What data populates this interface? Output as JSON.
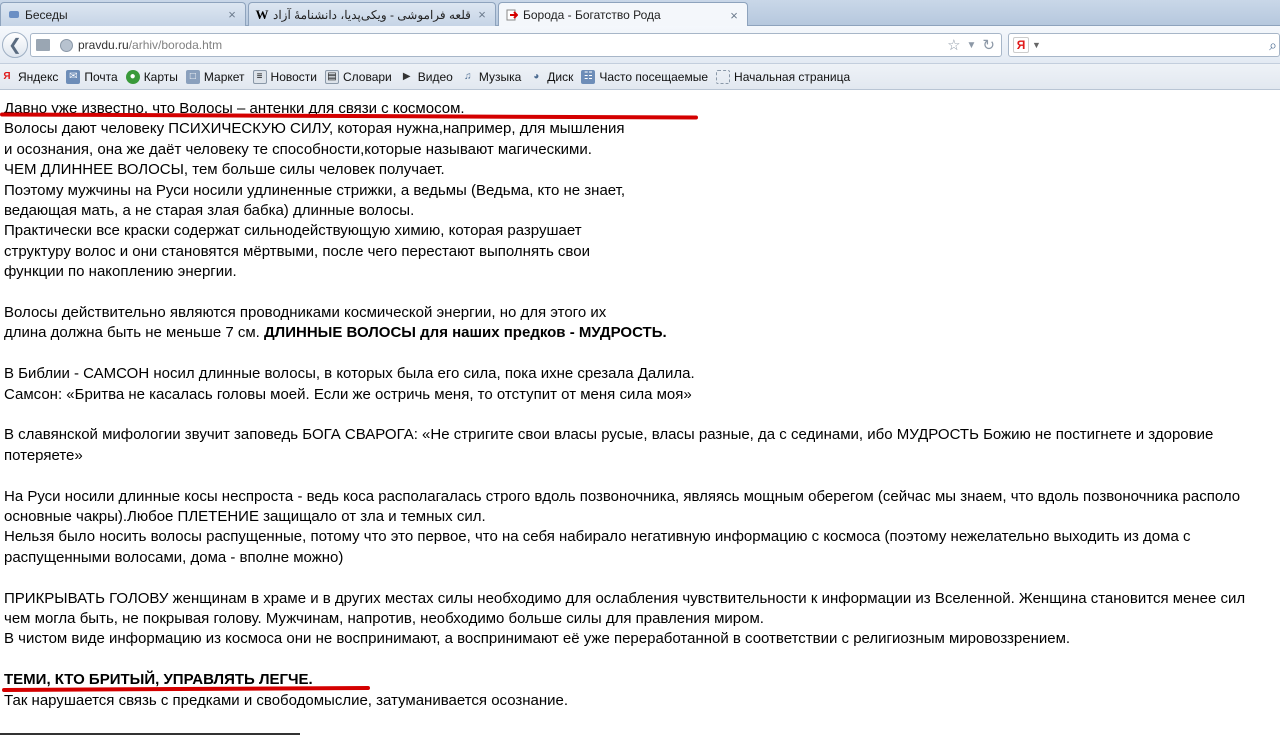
{
  "tabs": [
    {
      "title": "Беседы",
      "close": "×"
    },
    {
      "title": "قلعه فراموشی - ویکی‌پدیا، دانشنامهٔ آزاد",
      "close": "×"
    },
    {
      "title": "Борода - Богатство Рода",
      "close": "×"
    }
  ],
  "nav": {
    "url_domain": "pravdu.ru",
    "url_path": "/arhiv/boroda.htm",
    "search_brand": "Я"
  },
  "bookmarks": [
    {
      "label": "Яндекс",
      "icon": "yandex-icon"
    },
    {
      "label": "Почта",
      "icon": "mail-icon"
    },
    {
      "label": "Карты",
      "icon": "maps-icon"
    },
    {
      "label": "Маркет",
      "icon": "market-icon"
    },
    {
      "label": "Новости",
      "icon": "news-icon"
    },
    {
      "label": "Словари",
      "icon": "dictionary-icon"
    },
    {
      "label": "Видео",
      "icon": "video-icon"
    },
    {
      "label": "Музыка",
      "icon": "music-icon"
    },
    {
      "label": "Диск",
      "icon": "disk-icon"
    },
    {
      "label": "Часто посещаемые",
      "icon": "frequent-icon"
    },
    {
      "label": "Начальная страница",
      "icon": "page-icon"
    }
  ],
  "article": {
    "l01": "Давно уже известно, что Волосы – антенки для связи с космосом.",
    "l02": "Волосы дают человеку ПСИХИЧЕСКУЮ СИЛУ, которая нужна,например, для мышления",
    "l03": "и осознания, она же даёт человеку те способности,которые называют магическими.",
    "l04": "ЧЕМ ДЛИННЕЕ ВОЛОСЫ, тем больше силы человек получает.",
    "l05": "Поэтому мужчины на Руси носили удлиненные стрижки, а ведьмы (Ведьма, кто не знает,",
    "l06": "ведающая мать, а не старая злая бабка) длинные волосы.",
    "l07": "Практически все краски содержат сильнодействующую химию, которая разрушает",
    "l08": "структуру волос и они становятся мёртвыми, после чего перестают выполнять свои",
    "l09": "функции по накоплению энергии.",
    "l10": "Волосы действительно являются проводниками космической энергии, но для этого их",
    "l11a": "длина должна быть не меньше 7 см. ",
    "l11b": "ДЛИННЫЕ ВОЛОСЫ для наших предков - МУДРОСТЬ.",
    "l12": "В Библии - САМСОН носил длинные волосы, в которых была его сила, пока ихне срезала Далила.",
    "l13": "Самсон: «Бритва не касалась головы моей. Если же остричь меня, то отступит от меня сила моя»",
    "l14": "В славянской мифологии звучит заповедь БОГА СВАРОГА: «Не стригите свои власы русые, власы разные, да с сединами, ибо МУДРОСТЬ Божию не постигнете и здоровие",
    "l15": "потеряете»",
    "l16": "На Руси носили длинные косы неспроста - ведь коса располагалась строго вдоль позвоночника, являясь мощным оберегом (сейчас мы знаем, что вдоль позвоночника располо",
    "l17": "основные чакры).Любое ПЛЕТЕНИЕ защищало от зла и темных сил.",
    "l18": "Нельзя было носить волосы распущенные, потому что это первое, что на себя набирало негативную информацию с космоса (поэтому нежелательно выходить из дома с",
    "l19": "распущенными волосами, дома - вполне можно)",
    "l20": "ПРИКРЫВАТЬ ГОЛОВУ женщинам в храме и в других местах силы необходимо для ослабления чувствительности к информации из Вселенной. Женщина становится менее сил",
    "l21": "чем могла быть, не покрывая голову. Мужчинам, напротив, необходимо больше силы для правления миром.",
    "l22": "В чистом виде информацию из космоса они не воспринимают, а воспринимают её уже переработанной в соответствии с религиозным мировоззрением.",
    "l23": "ТЕМИ, КТО БРИТЫЙ, УПРАВЛЯТЬ ЛЕГЧЕ.",
    "l24": "Так нарушается связь с предками и свободомыслие, затуманивается осознание."
  },
  "colors": {
    "underline": "#d40000",
    "link_gray": "#808080"
  }
}
